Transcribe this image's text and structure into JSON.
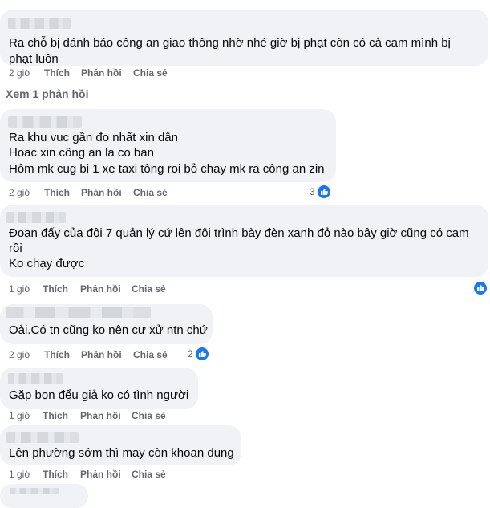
{
  "actions": {
    "like": "Thích",
    "reply": "Phản hồi",
    "share": "Chia sẻ"
  },
  "view_replies": "Xem 1 phản hồi",
  "comments": [
    {
      "time": "2 giờ",
      "lines": [
        "Ra chỗ bị đánh báo công an giao thông nhờ nhé giờ bị phạt còn có cả cam mình bị",
        "phạt luôn"
      ],
      "reactions": ""
    },
    {
      "time": "2 giờ",
      "lines": [
        "Ra khu vuc gần đo nhất xin dân",
        "Hoac xin công an la co ban",
        "Hôm mk cug bi 1 xe taxi tông roi bỏ chay mk ra công an zin"
      ],
      "reactions": "3"
    },
    {
      "time": "1 giờ",
      "lines": [
        "Đoạn đấy của đội 7 quản lý cứ lên đội trình bày đèn xanh đỏ nào bây giờ cũng có cam",
        "rồi",
        "Ko chạy được"
      ],
      "reactions": ""
    },
    {
      "time": "2 giờ",
      "lines": [
        "Oải.Có tn cũng ko nên cư xử ntn chứ"
      ],
      "reactions": "2"
    },
    {
      "time": "1 giờ",
      "lines": [
        "Gặp bọn đểu giả ko có tình người"
      ],
      "reactions": ""
    },
    {
      "time": "1 giờ",
      "lines": [
        "Lên phường sớm thì may còn khoan dung"
      ],
      "reactions": ""
    }
  ],
  "icons": {
    "reaction": "like-thumbs-up-icon"
  },
  "colors": {
    "bubble": "#f0f2f5",
    "meta": "#65676b",
    "like": "#1877f2"
  }
}
